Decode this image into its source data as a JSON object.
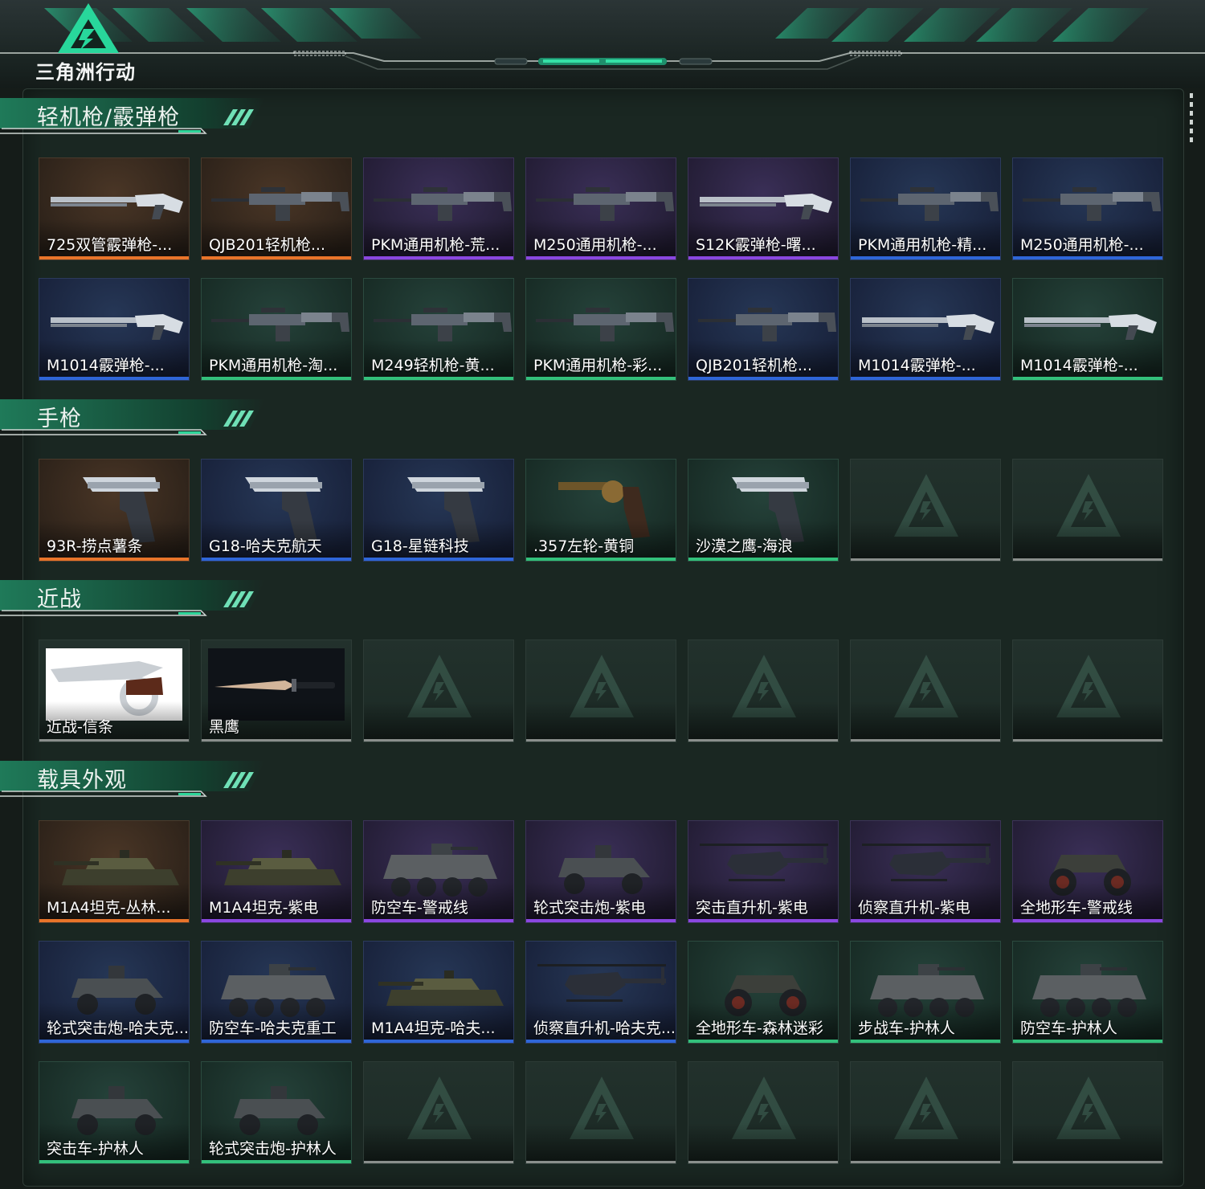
{
  "app": {
    "logo_text": "三角洲行动"
  },
  "colors": {
    "orange": "#e8742a",
    "purple": "#8a47e0",
    "blue": "#2f66d8",
    "green": "#33c07b",
    "accent": "#2fd69a"
  },
  "sections": [
    {
      "title": "轻机枪/霰弹枪",
      "items": [
        {
          "label": "725双管霰弹枪-...",
          "quality": "orange",
          "icon": "shotgun-icon"
        },
        {
          "label": "QJB201轻机枪...",
          "quality": "orange",
          "icon": "machinegun-icon"
        },
        {
          "label": "PKM通用机枪-荒...",
          "quality": "purple",
          "icon": "machinegun-icon"
        },
        {
          "label": "M250通用机枪-...",
          "quality": "purple",
          "icon": "machinegun-icon"
        },
        {
          "label": "S12K霰弹枪-曙...",
          "quality": "purple",
          "icon": "shotgun-icon"
        },
        {
          "label": "PKM通用机枪-精...",
          "quality": "blue",
          "icon": "machinegun-icon"
        },
        {
          "label": "M250通用机枪-...",
          "quality": "blue",
          "icon": "machinegun-icon"
        },
        {
          "label": "M1014霰弹枪-...",
          "quality": "blue",
          "icon": "shotgun-icon"
        },
        {
          "label": "PKM通用机枪-淘...",
          "quality": "green",
          "icon": "machinegun-icon"
        },
        {
          "label": "M249轻机枪-黄...",
          "quality": "green",
          "icon": "machinegun-icon"
        },
        {
          "label": "PKM通用机枪-彩...",
          "quality": "green",
          "icon": "machinegun-icon"
        },
        {
          "label": "QJB201轻机枪...",
          "quality": "blue",
          "icon": "machinegun-icon"
        },
        {
          "label": "M1014霰弹枪-...",
          "quality": "blue",
          "icon": "shotgun-icon"
        },
        {
          "label": "M1014霰弹枪-...",
          "quality": "green",
          "icon": "shotgun-icon"
        }
      ]
    },
    {
      "title": "手枪",
      "items": [
        {
          "label": "93R-捞点薯条",
          "quality": "orange",
          "icon": "pistol-icon"
        },
        {
          "label": "G18-哈夫克航天",
          "quality": "blue",
          "icon": "pistol-icon"
        },
        {
          "label": "G18-星链科技",
          "quality": "blue",
          "icon": "pistol-icon"
        },
        {
          "label": ".357左轮-黄铜",
          "quality": "green",
          "icon": "revolver-icon"
        },
        {
          "label": "沙漠之鹰-海浪",
          "quality": "green",
          "icon": "pistol-icon"
        },
        {
          "label": "",
          "quality": "empty",
          "icon": ""
        },
        {
          "label": "",
          "quality": "empty",
          "icon": ""
        }
      ]
    },
    {
      "title": "近战",
      "items": [
        {
          "label": "近战-信条",
          "quality": "empty",
          "icon": "knuckle-knife-icon"
        },
        {
          "label": "黑鹰",
          "quality": "empty",
          "icon": "knife-icon"
        },
        {
          "label": "",
          "quality": "empty",
          "icon": ""
        },
        {
          "label": "",
          "quality": "empty",
          "icon": ""
        },
        {
          "label": "",
          "quality": "empty",
          "icon": ""
        },
        {
          "label": "",
          "quality": "empty",
          "icon": ""
        },
        {
          "label": "",
          "quality": "empty",
          "icon": ""
        }
      ]
    },
    {
      "title": "载具外观",
      "items": [
        {
          "label": "M1A4坦克-丛林...",
          "quality": "orange",
          "icon": "tank-icon"
        },
        {
          "label": "M1A4坦克-紫电",
          "quality": "purple",
          "icon": "tank-icon"
        },
        {
          "label": "防空车-警戒线",
          "quality": "purple",
          "icon": "apc-icon"
        },
        {
          "label": "轮式突击炮-紫电",
          "quality": "purple",
          "icon": "armored-car-icon"
        },
        {
          "label": "突击直升机-紫电",
          "quality": "purple",
          "icon": "helicopter-icon"
        },
        {
          "label": "侦察直升机-紫电",
          "quality": "purple",
          "icon": "helicopter-icon"
        },
        {
          "label": "全地形车-警戒线",
          "quality": "purple",
          "icon": "atv-icon"
        },
        {
          "label": "轮式突击炮-哈夫克...",
          "quality": "blue",
          "icon": "armored-car-icon"
        },
        {
          "label": "防空车-哈夫克重工",
          "quality": "blue",
          "icon": "apc-icon"
        },
        {
          "label": "M1A4坦克-哈夫...",
          "quality": "blue",
          "icon": "tank-icon"
        },
        {
          "label": "侦察直升机-哈夫克...",
          "quality": "blue",
          "icon": "helicopter-icon"
        },
        {
          "label": "全地形车-森林迷彩",
          "quality": "green",
          "icon": "atv-icon"
        },
        {
          "label": "步战车-护林人",
          "quality": "green",
          "icon": "apc-icon"
        },
        {
          "label": "防空车-护林人",
          "quality": "green",
          "icon": "apc-icon"
        },
        {
          "label": "突击车-护林人",
          "quality": "green",
          "icon": "armored-car-icon"
        },
        {
          "label": "轮式突击炮-护林人",
          "quality": "green",
          "icon": "armored-car-icon"
        },
        {
          "label": "",
          "quality": "empty",
          "icon": ""
        },
        {
          "label": "",
          "quality": "empty",
          "icon": ""
        },
        {
          "label": "",
          "quality": "empty",
          "icon": ""
        },
        {
          "label": "",
          "quality": "empty",
          "icon": ""
        },
        {
          "label": "",
          "quality": "empty",
          "icon": ""
        }
      ]
    }
  ]
}
